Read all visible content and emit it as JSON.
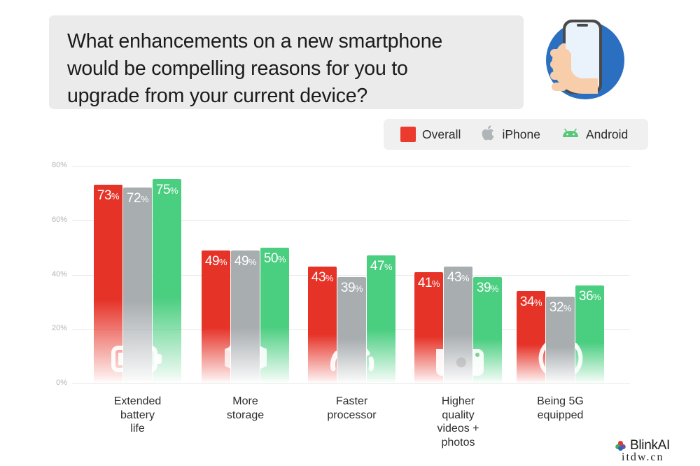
{
  "question": {
    "lines": [
      "What enhancements on a new smartphone",
      "would be compelling reasons for you to",
      "upgrade from your current device?"
    ]
  },
  "illustration": {
    "name": "hand-holding-smartphone",
    "circle_color": "#2a6fc0",
    "skin_color": "#f8cdaa",
    "screen_color": "#eaf3fb"
  },
  "legend": {
    "items": [
      {
        "label": "Overall",
        "icon": "red-square-icon",
        "color": "#ea3b2e"
      },
      {
        "label": "iPhone",
        "icon": "apple-logo-icon",
        "color": "#b0b5b8"
      },
      {
        "label": "Android",
        "icon": "android-robot-icon",
        "color": "#56c878"
      }
    ]
  },
  "watermark": {
    "brand": "BlinkAI",
    "url": "itdw.cn"
  },
  "chart_data": {
    "type": "bar",
    "title": "What enhancements on a new smartphone would be compelling reasons for you to upgrade from your current device?",
    "xlabel": "",
    "ylabel": "",
    "ylim": [
      0,
      80
    ],
    "yticks": [
      "0%",
      "20%",
      "40%",
      "60%",
      "80%"
    ],
    "ytick_values": [
      0,
      20,
      40,
      60,
      80
    ],
    "grid": true,
    "legend_position": "top-right",
    "categories": [
      "Extended battery life",
      "More storage",
      "Faster processor",
      "Higher quality videos + photos",
      "Being 5G equipped"
    ],
    "category_label_lines": [
      [
        "Extended",
        "battery",
        "life"
      ],
      [
        "More",
        "storage"
      ],
      [
        "Faster",
        "processor"
      ],
      [
        "Higher",
        "quality",
        "videos +",
        "photos"
      ],
      [
        "Being 5G",
        "equipped"
      ]
    ],
    "category_icons": [
      "battery-icon",
      "package-box-icon",
      "speedometer-icon",
      "camera-icon",
      "signal-waves-icon"
    ],
    "series": [
      {
        "name": "Overall",
        "color": "#e63328",
        "values": [
          73,
          49,
          43,
          41,
          34
        ],
        "labels": [
          "73%",
          "49%",
          "43%",
          "41%",
          "34%"
        ]
      },
      {
        "name": "iPhone",
        "color": "#a8adb0",
        "values": [
          72,
          49,
          39,
          43,
          32
        ],
        "labels": [
          "72%",
          "49%",
          "39%",
          "43%",
          "32%"
        ]
      },
      {
        "name": "Android",
        "color": "#4ace80",
        "values": [
          75,
          50,
          47,
          39,
          36
        ],
        "labels": [
          "75%",
          "50%",
          "47%",
          "39%",
          "36%"
        ]
      }
    ]
  }
}
